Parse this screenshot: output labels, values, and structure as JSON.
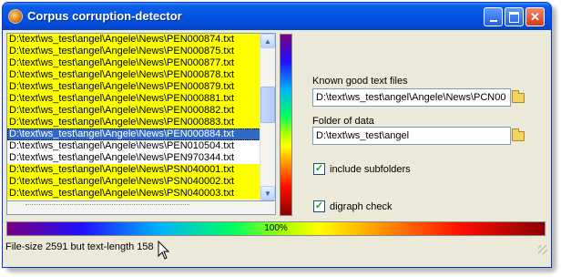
{
  "window": {
    "title": "Corpus corruption-detector",
    "minimize_label": "_",
    "maximize_label": "□",
    "close_label": "✕"
  },
  "file_list": {
    "items": [
      {
        "path": "D:\\text\\ws_test\\angel\\Angele\\News\\PEN000874.txt",
        "state": "yellow"
      },
      {
        "path": "D:\\text\\ws_test\\angel\\Angele\\News\\PEN000875.txt",
        "state": "yellow"
      },
      {
        "path": "D:\\text\\ws_test\\angel\\Angele\\News\\PEN000877.txt",
        "state": "yellow"
      },
      {
        "path": "D:\\text\\ws_test\\angel\\Angele\\News\\PEN000878.txt",
        "state": "yellow"
      },
      {
        "path": "D:\\text\\ws_test\\angel\\Angele\\News\\PEN000879.txt",
        "state": "yellow"
      },
      {
        "path": "D:\\text\\ws_test\\angel\\Angele\\News\\PEN000881.txt",
        "state": "yellow"
      },
      {
        "path": "D:\\text\\ws_test\\angel\\Angele\\News\\PEN000882.txt",
        "state": "yellow"
      },
      {
        "path": "D:\\text\\ws_test\\angel\\Angele\\News\\PEN000883.txt",
        "state": "yellow"
      },
      {
        "path": "D:\\text\\ws_test\\angel\\Angele\\News\\PEN000884.txt",
        "state": "selected"
      },
      {
        "path": "D:\\text\\ws_test\\angel\\Angele\\News\\PEN010504.txt",
        "state": "white"
      },
      {
        "path": "D:\\text\\ws_test\\angel\\Angele\\News\\PEN970344.txt",
        "state": "white"
      },
      {
        "path": "D:\\text\\ws_test\\angel\\Angele\\News\\PSN040001.txt",
        "state": "yellow"
      },
      {
        "path": "D:\\text\\ws_test\\angel\\Angele\\News\\PSN040002.txt",
        "state": "yellow"
      },
      {
        "path": "D:\\text\\ws_test\\angel\\Angele\\News\\PSN040003.txt",
        "state": "yellow"
      }
    ]
  },
  "known_good": {
    "label": "Known good text files",
    "value": "D:\\text\\ws_test\\angel\\Angele\\News\\PCN00"
  },
  "data_folder": {
    "label": "Folder of data",
    "value": "D:\\text\\ws_test\\angel"
  },
  "options": {
    "include_subfolders": {
      "label": "include subfolders",
      "checked": true
    },
    "digraph_check": {
      "label": "digraph check",
      "checked": true
    }
  },
  "progress": {
    "percent": 100,
    "text": "100%"
  },
  "status": {
    "text": "File-size 2591 but text-length 158"
  },
  "colors": {
    "title_bar": "#0554e3",
    "highlight_row": "#ffff00",
    "selected_row": "#316ac5",
    "window_bg": "#ece9d8"
  }
}
